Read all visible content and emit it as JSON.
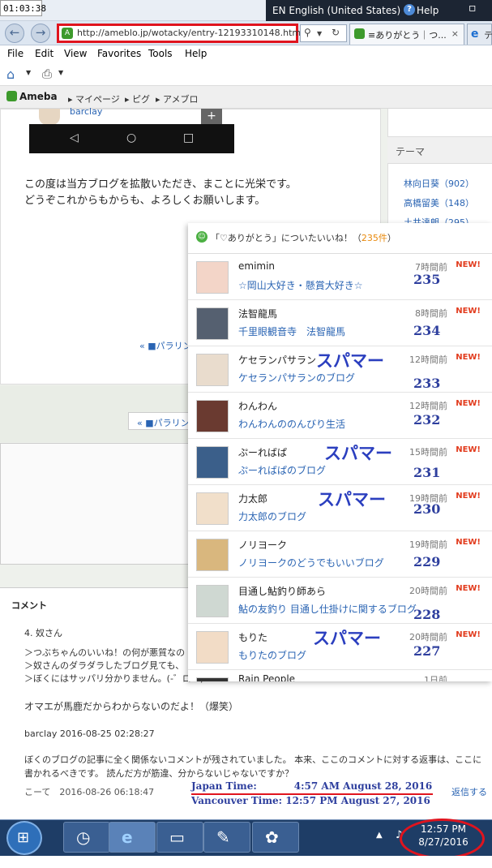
{
  "window": {
    "clock": "01:03:38",
    "language": "EN English (United States)",
    "help": "Help"
  },
  "browser": {
    "url": "http://ameblo.jp/wotacky/entry-12193310148.html",
    "tabs": [
      {
        "title": "≡ありがとう｜つ...",
        "close": "×"
      },
      {
        "title": "テ"
      }
    ],
    "menu": [
      "File",
      "Edit",
      "View",
      "Favorites",
      "Tools",
      "Help"
    ]
  },
  "ameba": {
    "logo": "Ameba",
    "links": [
      "マイページ",
      "ピグ",
      "アメブロ"
    ]
  },
  "post": {
    "author_top": "barclay",
    "plus": "+",
    "phone_nav": [
      "◁",
      "○",
      "□"
    ],
    "body": [
      "この度は当方ブログを拡散いただき、まことに光栄です。",
      "どうぞこれからもからも、よろしくお願いします。"
    ],
    "prev_link_1": "« ■パラリン",
    "prev_link_2": "« ■パラリン"
  },
  "sidebar": {
    "theme_head": "テーマ",
    "items": [
      "林向日葵（902）",
      "高橋留美（148）",
      "土井達朗（295）"
    ]
  },
  "popup": {
    "title_pre": "「♡ありがとう」についたいいね！（",
    "count": "235件",
    "title_post": "）",
    "spammer_label": "スパマー",
    "rows": [
      {
        "name": "emimin",
        "blog": "☆岡山大好き・懸賞大好き☆",
        "time": "7時間前",
        "new": "NEW!",
        "num": "235"
      },
      {
        "name": "法智龍馬",
        "blog": "千里眼観音寺　法智龍馬",
        "time": "8時間前",
        "new": "NEW!",
        "num": "234"
      },
      {
        "name": "ケセランパサラン",
        "blog": "ケセランパサランのブログ",
        "time": "12時間前",
        "new": "NEW!",
        "num": "233"
      },
      {
        "name": "わんわん",
        "blog": "わんわんののんびり生活",
        "time": "12時間前",
        "new": "NEW!",
        "num": "232"
      },
      {
        "name": "ぷーればぱ",
        "blog": "ぷーればぱのブログ",
        "time": "15時間前",
        "new": "NEW!",
        "num": "231"
      },
      {
        "name": "力太郎",
        "blog": "力太郎のブログ",
        "time": "19時間前",
        "new": "NEW!",
        "num": "230"
      },
      {
        "name": "ノリヨーク",
        "blog": "ノリヨークのどうでもいいブログ",
        "time": "19時間前",
        "new": "NEW!",
        "num": "229"
      },
      {
        "name": "目通し鮎釣り師あら",
        "blog": "鮎の友釣り 目通し仕掛けに関するブログ",
        "time": "20時間前",
        "new": "NEW!",
        "num": "228"
      },
      {
        "name": "もりた",
        "blog": "もりたのブログ",
        "time": "20時間前",
        "new": "NEW!",
        "num": "227"
      },
      {
        "name": "Rain People",
        "blog": "",
        "time": "1日前",
        "new": "",
        "num": ""
      }
    ]
  },
  "comments": {
    "head": "コメント",
    "number": "4. 奴さん",
    "lines": [
      "＞つぶちゃんのいいね！の何が悪質なの",
      "＞奴さんのダラダラしたブログ見ても、",
      "＞ぼくにはサッパリ分かりません。(-゛ロ゛)"
    ],
    "reply_line": "オマエが馬鹿だからわからないのだよ！（爆笑）",
    "author": "barclay 2016-08-25 02:28:27",
    "body": "ぼくのブログの記事に全く関係ないコメントが残されていました。 本来、ここのコメントに対する返事は、ここに書かれるべきです。 読んだ方が筋違、分からないじゃないですか？",
    "author2": "こーて　2016-08-26 06:18:47",
    "reply": "返信する"
  },
  "annotation": {
    "japan_label": "Japan Time:",
    "japan_time": "4:57 AM August 28, 2016",
    "vancouver": "Vancouver Time: 12:57 PM August 27, 2016"
  },
  "taskbar": {
    "time": "12:57 PM",
    "date": "8/27/2016"
  }
}
